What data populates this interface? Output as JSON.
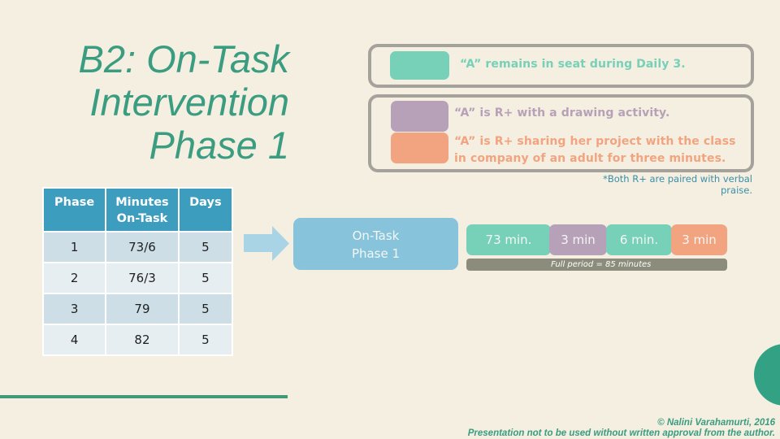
{
  "slide": {
    "title_lines": [
      "B2: On-Task",
      "Intervention",
      "Phase 1"
    ]
  },
  "legend": {
    "colors": {
      "teal": "#77d0b8",
      "purple": "#b7a1b8",
      "orange": "#f2a481"
    },
    "items": [
      {
        "color": "teal",
        "text": "“A” remains in seat during Daily 3."
      },
      {
        "color": "purple",
        "text": "“A” is R+ with a drawing activity."
      },
      {
        "color": "orange",
        "text": "“A” is R+ sharing her project with the class in company of an adult for three minutes."
      }
    ],
    "note": "*Both R+ are paired with verbal praise."
  },
  "table": {
    "headers": [
      "Phase",
      "Minutes On-Task",
      "Days"
    ],
    "header_color": "#3d9dbf",
    "rows": [
      [
        "1",
        "73/6",
        "5"
      ],
      [
        "2",
        "76/3",
        "5"
      ],
      [
        "3",
        "79",
        "5"
      ],
      [
        "4",
        "82",
        "5"
      ]
    ]
  },
  "flow": {
    "arrow_icon": "right-arrow-icon",
    "phase_box": {
      "line1": "On-Task",
      "line2": "Phase 1",
      "color": "#87c4dc"
    },
    "timeline": [
      {
        "label": "73 min.",
        "color": "teal",
        "minutes": 73
      },
      {
        "label": "3 min",
        "color": "purple",
        "minutes": 3
      },
      {
        "label": "6 min.",
        "color": "teal",
        "minutes": 6
      },
      {
        "label": "3 min",
        "color": "orange",
        "minutes": 3
      }
    ],
    "period_label": "Full period = 85 minutes",
    "period_total_minutes": 85
  },
  "footer": {
    "copyright": "© Nalini Varahamurti, 2016",
    "notice": "Presentation not to be used without written approval from the author."
  },
  "theme": {
    "background": "#f4efe0",
    "accent": "#3a9c80"
  }
}
